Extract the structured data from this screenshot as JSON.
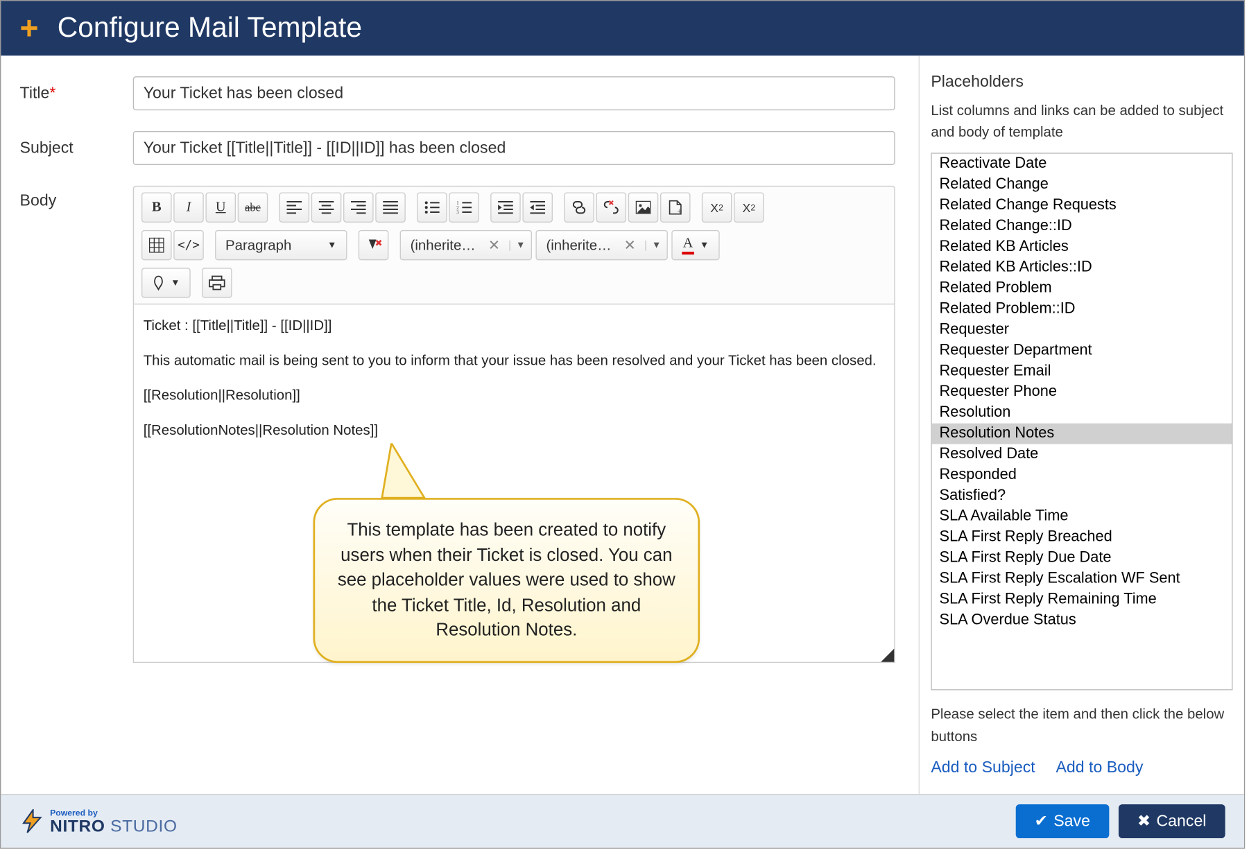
{
  "header": {
    "title": "Configure Mail Template"
  },
  "form": {
    "title_label": "Title",
    "title_value": "Your Ticket has been closed",
    "subject_label": "Subject",
    "subject_value": "Your Ticket [[Title||Title]] - [[ID||ID]] has been closed",
    "body_label": "Body"
  },
  "toolbar": {
    "paragraph": "Paragraph",
    "inherit1": "(inherite…",
    "inherit2": "(inherite…",
    "color_letter": "A"
  },
  "editor": {
    "line1": "Ticket : [[Title||Title]] - [[ID||ID]]",
    "line2": "This automatic mail is being sent to you to inform that your issue has been resolved and your Ticket has been closed.",
    "line3": "[[Resolution||Resolution]]",
    "line4": "[[ResolutionNotes||Resolution Notes]]"
  },
  "callout": {
    "text": "This template has been created to notify users when their Ticket is closed. You can see placeholder values were used to show the Ticket Title, Id, Resolution and Resolution Notes."
  },
  "right": {
    "heading": "Placeholders",
    "desc": "List columns and links can be added to subject and body of template",
    "items": [
      "Reactivate Date",
      "Related Change",
      "Related Change Requests",
      "Related Change::ID",
      "Related KB Articles",
      "Related KB Articles::ID",
      "Related Problem",
      "Related Problem::ID",
      "Requester",
      "Requester Department",
      "Requester Email",
      "Requester Phone",
      "Resolution",
      "Resolution Notes",
      "Resolved Date",
      "Responded",
      "Satisfied?",
      "SLA Available Time",
      "SLA First Reply Breached",
      "SLA First Reply Due Date",
      "SLA First Reply Escalation WF Sent",
      "SLA First Reply Remaining Time",
      "SLA Overdue Status"
    ],
    "selected_index": 13,
    "help": "Please select the item and then click the below buttons",
    "add_subject": "Add to Subject",
    "add_body": "Add to Body"
  },
  "footer": {
    "powered": "Powered by",
    "brand_main": "NITRO",
    "brand_sub": "STUDIO",
    "save": "Save",
    "cancel": "Cancel"
  }
}
